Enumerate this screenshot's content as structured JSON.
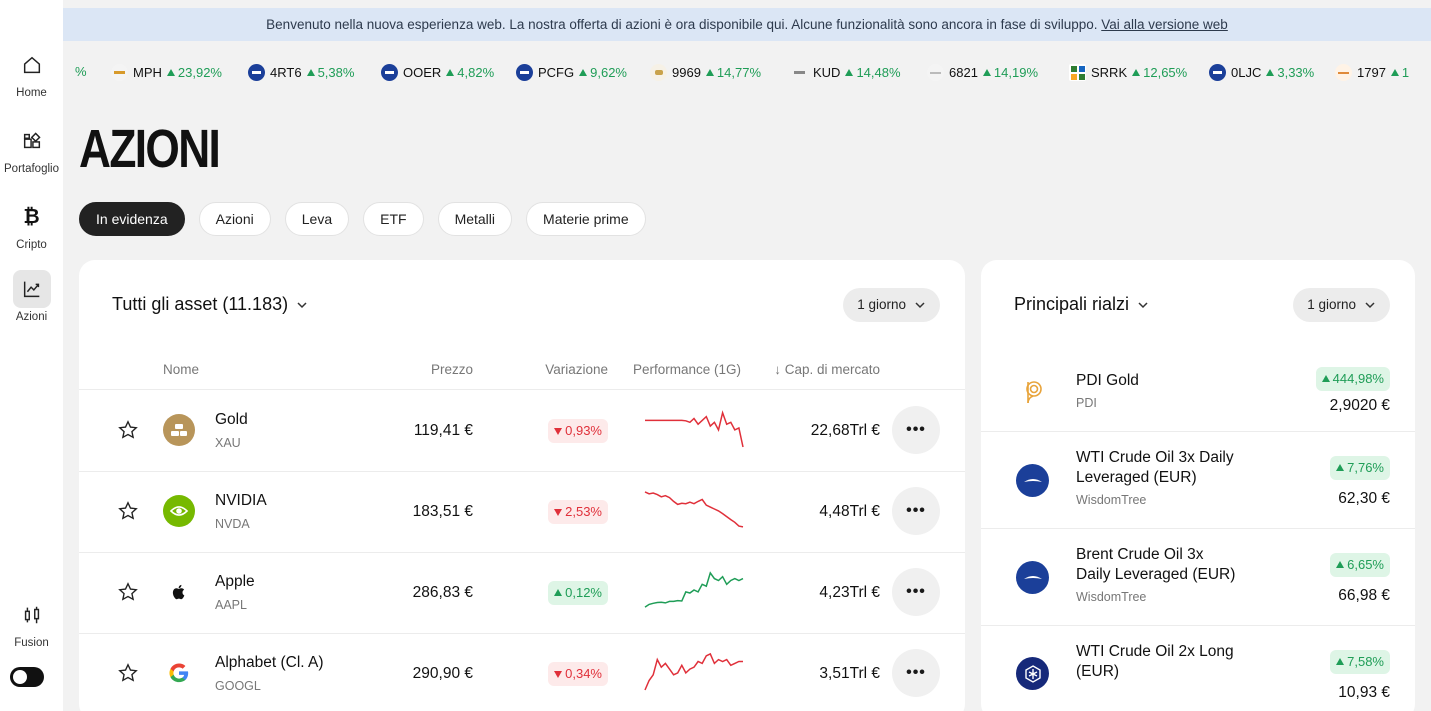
{
  "banner": {
    "text": "Benvenuto nella nuova esperienza web. La nostra offerta di azioni è ora disponibile qui. Alcune funzionalità sono ancora in fase di sviluppo.",
    "link": "Vai alla versione web"
  },
  "sidebar": {
    "items": [
      {
        "label": "Home",
        "icon": "home-icon"
      },
      {
        "label": "Portafoglio",
        "icon": "portfolio-icon"
      },
      {
        "label": "Cripto",
        "icon": "bitcoin-icon"
      },
      {
        "label": "Azioni",
        "icon": "chart-icon"
      }
    ],
    "fusion_label": "Fusion"
  },
  "ticker": [
    {
      "sym": "",
      "chg": "%"
    },
    {
      "sym": "MPH",
      "chg": "23,92%"
    },
    {
      "sym": "4RT6",
      "chg": "5,38%"
    },
    {
      "sym": "OOER",
      "chg": "4,82%"
    },
    {
      "sym": "PCFG",
      "chg": "9,62%"
    },
    {
      "sym": "9969",
      "chg": "14,77%"
    },
    {
      "sym": "KUD",
      "chg": "14,48%"
    },
    {
      "sym": "6821",
      "chg": "14,19%"
    },
    {
      "sym": "SRRK",
      "chg": "12,65%"
    },
    {
      "sym": "0LJC",
      "chg": "3,33%"
    },
    {
      "sym": "1797",
      "chg": "1"
    }
  ],
  "page_title": "AZIONI",
  "filters": [
    "In evidenza",
    "Azioni",
    "Leva",
    "ETF",
    "Metalli",
    "Materie prime"
  ],
  "main_panel": {
    "title": "Tutti gli asset (11.183)",
    "period": "1 giorno",
    "columns": {
      "name": "Nome",
      "price": "Prezzo",
      "change": "Variazione",
      "performance": "Performance (1G)",
      "market_cap": "Cap. di mercato"
    },
    "rows": [
      {
        "name": "Gold",
        "symbol": "XAU",
        "price": "119,41 €",
        "change": "0,93%",
        "direction": "down",
        "cap": "22,68Trl €",
        "spark": [
          0.3,
          0.3,
          0.3,
          0.3,
          0.3,
          0.3,
          0.3,
          0.3,
          0.3,
          0.3,
          0.31,
          0.35,
          0.25,
          0.4,
          0.3,
          0.2,
          0.45,
          0.35,
          0.55,
          0.1,
          0.4,
          0.35,
          0.55,
          0.5,
          1.0
        ]
      },
      {
        "name": "NVIDIA",
        "symbol": "NVDA",
        "price": "183,51 €",
        "change": "2,53%",
        "direction": "down",
        "cap": "4,48Trl €",
        "spark": [
          0.05,
          0.1,
          0.08,
          0.12,
          0.18,
          0.15,
          0.2,
          0.3,
          0.38,
          0.35,
          0.36,
          0.32,
          0.36,
          0.3,
          0.25,
          0.4,
          0.45,
          0.5,
          0.55,
          0.62,
          0.7,
          0.78,
          0.85,
          0.95,
          0.97
        ]
      },
      {
        "name": "Apple",
        "symbol": "AAPL",
        "price": "286,83 €",
        "change": "0,12%",
        "direction": "up",
        "cap": "4,23Trl €",
        "spark": [
          0.95,
          0.88,
          0.85,
          0.83,
          0.82,
          0.84,
          0.8,
          0.8,
          0.78,
          0.79,
          0.55,
          0.58,
          0.5,
          0.55,
          0.35,
          0.4,
          0.05,
          0.2,
          0.25,
          0.15,
          0.35,
          0.25,
          0.2,
          0.25,
          0.2
        ]
      },
      {
        "name": "Alphabet (Cl. A)",
        "symbol": "GOOGL",
        "price": "290,90 €",
        "change": "0,34%",
        "direction": "down",
        "cap": "3,51Trl €",
        "spark": [
          1.0,
          0.75,
          0.6,
          0.2,
          0.4,
          0.3,
          0.45,
          0.6,
          0.55,
          0.35,
          0.55,
          0.45,
          0.4,
          0.25,
          0.3,
          0.1,
          0.05,
          0.3,
          0.2,
          0.25,
          0.2,
          0.35,
          0.3,
          0.25,
          0.25
        ]
      }
    ]
  },
  "side_panel": {
    "title": "Principali rialzi",
    "period": "1 giorno",
    "items": [
      {
        "name": "PDI Gold",
        "sub": "PDI",
        "change": "444,98%",
        "price": "2,9020 €"
      },
      {
        "name": "WTI Crude Oil 3x Daily Leveraged (EUR)",
        "sub": "WisdomTree",
        "change": "7,76%",
        "price": "62,30 €"
      },
      {
        "name": "Brent Crude Oil 3x Daily Leveraged (EUR)",
        "sub": "WisdomTree",
        "change": "6,65%",
        "price": "66,98 €"
      },
      {
        "name": "WTI Crude Oil 2x Long (EUR)",
        "sub": "",
        "change": "7,58%",
        "price": "10,93 €"
      }
    ]
  },
  "colors": {
    "up": "#1f9d57",
    "down": "#e0303a",
    "accent_dark": "#222222",
    "banner_bg": "#dbe6f5"
  }
}
